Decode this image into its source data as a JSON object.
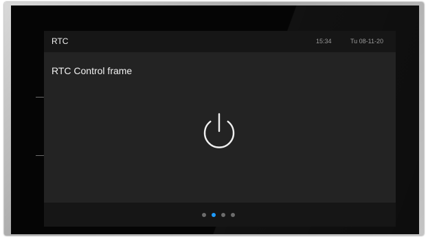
{
  "header": {
    "title": "RTC",
    "time": "15:34",
    "date": "Tu 08-11-20"
  },
  "main": {
    "frame_title": "RTC Control frame",
    "power_icon": "power-icon"
  },
  "pager": {
    "page_count": 4,
    "active_page": 2
  },
  "colors": {
    "accent": "#1e9bff",
    "screen_bg": "#232323",
    "bar_bg": "#161616",
    "text": "#f2f2f2"
  }
}
